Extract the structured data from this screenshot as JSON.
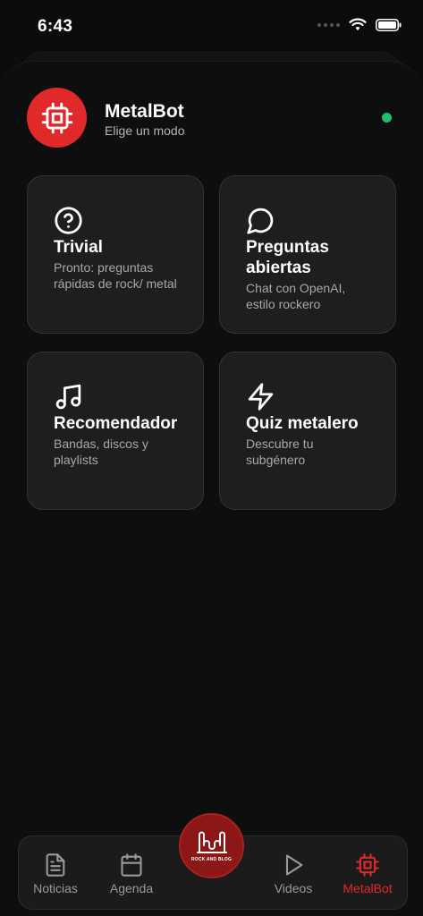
{
  "status_bar": {
    "time": "6:43"
  },
  "header": {
    "title": "MetalBot",
    "subtitle": "Elige un modo"
  },
  "modes": [
    {
      "title": "Trivial",
      "description": "Pronto: preguntas rápidas de rock/ metal",
      "icon": "question-circle-icon"
    },
    {
      "title": "Preguntas abiertas",
      "description": "Chat con OpenAI, estilo rockero",
      "icon": "chat-bubble-icon"
    },
    {
      "title": "Recomendador",
      "description": "Bandas, discos y playlists",
      "icon": "music-note-icon"
    },
    {
      "title": "Quiz metalero",
      "description": "Descubre tu subgénero",
      "icon": "lightning-bolt-icon"
    }
  ],
  "tab_bar": {
    "tabs": [
      {
        "label": "Noticias",
        "icon": "document-icon",
        "active": false
      },
      {
        "label": "Agenda",
        "icon": "calendar-icon",
        "active": false
      },
      {
        "label": "Videos",
        "icon": "play-icon",
        "active": false
      },
      {
        "label": "MetalBot",
        "icon": "chip-icon",
        "active": true
      }
    ],
    "center_logo_text": "ROCK AND BLOG"
  },
  "colors": {
    "accent": "#e02a2a",
    "online": "#1fbf6b",
    "background": "#0e0e0e",
    "card": "#1e1e1e"
  }
}
